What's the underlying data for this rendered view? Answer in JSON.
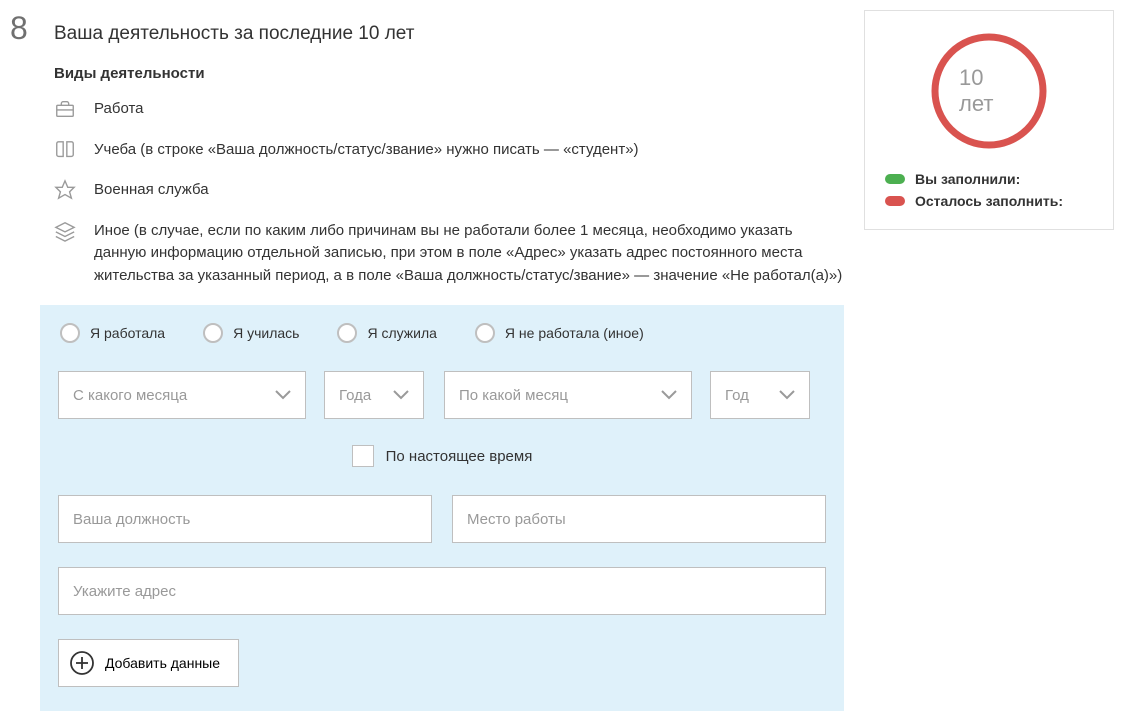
{
  "section": {
    "number": "8",
    "title": "Ваша деятельность за последние 10 лет",
    "subtitle": "Виды деятельности"
  },
  "legend": {
    "work": "Работа",
    "study": "Учеба (в строке «Ваша должность/статус/звание» нужно писать — «студент»)",
    "military": "Военная служба",
    "other": "Иное (в случае, если по каким либо причинам вы не работали более 1 месяца, необходимо указать данную информацию отдельной записью, при этом в поле «Адрес» указать адрес постоянного места жительства за указанный период, а в поле «Ваша должность/статус/звание» — значение «Не работал(а)»)"
  },
  "form": {
    "radios": {
      "worked": "Я работала",
      "studied": "Я училась",
      "served": "Я служила",
      "notWorked": "Я не работала (иное)"
    },
    "selects": {
      "fromMonth": "С какого месяца",
      "fromYear": "Года",
      "toMonth": "По какой месяц",
      "toYear": "Год"
    },
    "checkbox": {
      "present": "По настоящее время"
    },
    "inputs": {
      "position": "Ваша должность",
      "workplace": "Место работы",
      "address": "Укажите адрес"
    },
    "addButton": "Добавить данные"
  },
  "sidebar": {
    "period": "10 лет",
    "filled": "Вы заполнили:",
    "remaining": "Осталось заполнить:"
  }
}
